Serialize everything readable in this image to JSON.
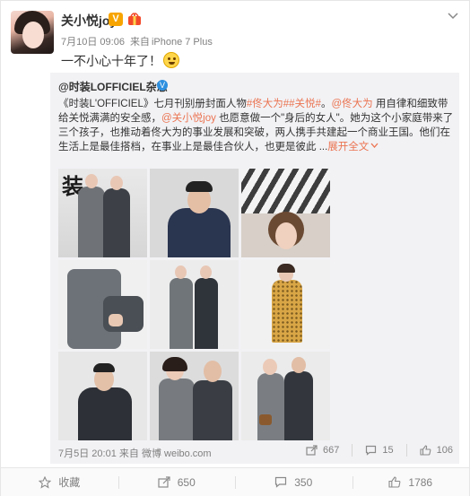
{
  "post": {
    "username": "关小悦joy",
    "vip_label": "V",
    "timestamp": "7月10日 09:06",
    "source_prefix": "来自",
    "source": "iPhone 7 Plus",
    "text": "一不小心十年了！"
  },
  "repost": {
    "author": "@时装LOFFICIEL杂志",
    "body_parts": {
      "p1": "《时装L'OFFICIEL》七月刊别册封面人物",
      "tag1": "#佟大为#",
      "tag2": "#关悦#",
      "p2": "。",
      "mention1": "@佟大为",
      "p3": " 用自律和细致带给关悦满满的安全感，",
      "mention2": "@关小悦joy",
      "p4": " 也愿意做一个\"身后的女人\"。她为这个小家庭带来了三个孩子，也推动着佟大为的事业发展和突破，两人携手共建起一个商业王国。他们在生活上是最佳搭档，在事业上是最佳合伙人，也更是彼此 ...",
      "expand": "展开全文",
      "expand_icon": "chevron-down"
    },
    "magazine_word": "装",
    "date": "7月5日 20:01",
    "source_prefix": "来自",
    "source": "微博 weibo.com",
    "share_count": "667",
    "comment_count": "15",
    "like_count": "106"
  },
  "toolbar": {
    "favorite_label": "收藏",
    "share_count": "650",
    "comment_count": "350",
    "like_count": "1786"
  },
  "colors": {
    "accent": "#eb7350",
    "verify": "#2d8fdf",
    "vip": "#f7a400"
  }
}
